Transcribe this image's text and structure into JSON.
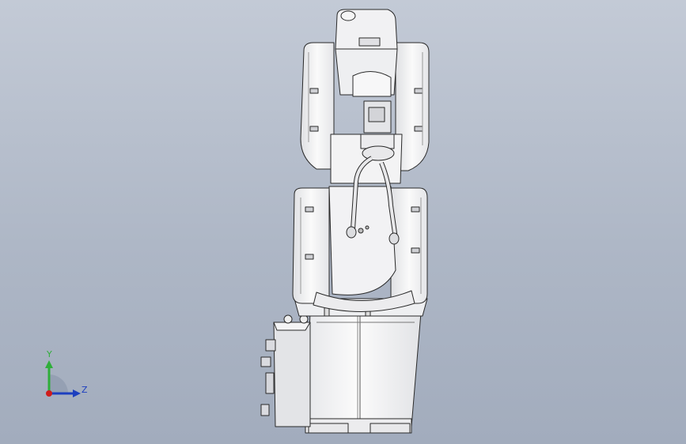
{
  "viewport": {
    "background_top": "#c3cad6",
    "background_bottom": "#a2acbd",
    "model": "robot-arm-side-view"
  },
  "triad": {
    "y_label": "Y",
    "z_label": "Z",
    "y_color": "#2fae3a",
    "z_color": "#1d3fbf",
    "x_color": "#d01c1c"
  },
  "colors": {
    "body_fill": "#f4f4f4",
    "shade_fill": "#dcdde0",
    "edge": "#2a2a2a"
  }
}
